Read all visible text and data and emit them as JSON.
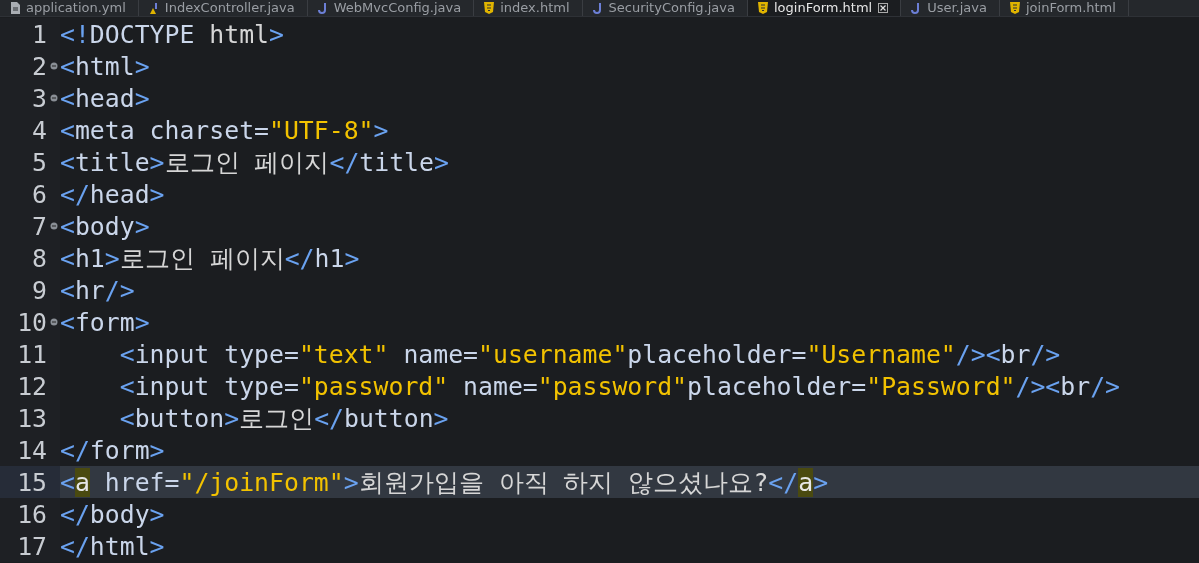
{
  "tabs": [
    {
      "label": "application.yml",
      "kind": "file",
      "selected": false
    },
    {
      "label": "IndexController.java",
      "kind": "java-warning",
      "selected": false
    },
    {
      "label": "WebMvcConfig.java",
      "kind": "java",
      "selected": false
    },
    {
      "label": "index.html",
      "kind": "html",
      "selected": false
    },
    {
      "label": "SecurityConfig.java",
      "kind": "java",
      "selected": false
    },
    {
      "label": "loginForm.html",
      "kind": "html",
      "selected": true
    },
    {
      "label": "User.java",
      "kind": "java",
      "selected": false
    },
    {
      "label": "joinForm.html",
      "kind": "html",
      "selected": false
    }
  ],
  "lines": [
    {
      "number": "1",
      "foldable": false,
      "current": false,
      "tokens": [
        {
          "kind": "punct",
          "text": "<!"
        },
        {
          "kind": "name",
          "text": "DOCTYPE"
        },
        {
          "kind": "text",
          "text": " html"
        },
        {
          "kind": "punct",
          "text": ">"
        }
      ]
    },
    {
      "number": "2",
      "foldable": true,
      "current": false,
      "tokens": [
        {
          "kind": "punct",
          "text": "<"
        },
        {
          "kind": "name",
          "text": "html"
        },
        {
          "kind": "punct",
          "text": ">"
        }
      ]
    },
    {
      "number": "3",
      "foldable": true,
      "current": false,
      "tokens": [
        {
          "kind": "punct",
          "text": "<"
        },
        {
          "kind": "name",
          "text": "head"
        },
        {
          "kind": "punct",
          "text": ">"
        }
      ]
    },
    {
      "number": "4",
      "foldable": false,
      "current": false,
      "tokens": [
        {
          "kind": "punct",
          "text": "<"
        },
        {
          "kind": "name",
          "text": "meta charset="
        },
        {
          "kind": "string",
          "text": "\"UTF-8\""
        },
        {
          "kind": "punct",
          "text": ">"
        }
      ]
    },
    {
      "number": "5",
      "foldable": false,
      "current": false,
      "tokens": [
        {
          "kind": "punct",
          "text": "<"
        },
        {
          "kind": "name",
          "text": "title"
        },
        {
          "kind": "punct",
          "text": ">"
        },
        {
          "kind": "text",
          "text": "로그인 페이지"
        },
        {
          "kind": "punct",
          "text": "</"
        },
        {
          "kind": "name",
          "text": "title"
        },
        {
          "kind": "punct",
          "text": ">"
        }
      ]
    },
    {
      "number": "6",
      "foldable": false,
      "current": false,
      "tokens": [
        {
          "kind": "punct",
          "text": "</"
        },
        {
          "kind": "name",
          "text": "head"
        },
        {
          "kind": "punct",
          "text": ">"
        }
      ]
    },
    {
      "number": "7",
      "foldable": true,
      "current": false,
      "tokens": [
        {
          "kind": "punct",
          "text": "<"
        },
        {
          "kind": "name",
          "text": "body"
        },
        {
          "kind": "punct",
          "text": ">"
        }
      ]
    },
    {
      "number": "8",
      "foldable": false,
      "current": false,
      "tokens": [
        {
          "kind": "punct",
          "text": "<"
        },
        {
          "kind": "name",
          "text": "h1"
        },
        {
          "kind": "punct",
          "text": ">"
        },
        {
          "kind": "text",
          "text": "로그인 페이지"
        },
        {
          "kind": "punct",
          "text": "</"
        },
        {
          "kind": "name",
          "text": "h1"
        },
        {
          "kind": "punct",
          "text": ">"
        }
      ]
    },
    {
      "number": "9",
      "foldable": false,
      "current": false,
      "tokens": [
        {
          "kind": "punct",
          "text": "<"
        },
        {
          "kind": "name",
          "text": "hr"
        },
        {
          "kind": "punct",
          "text": "/>"
        }
      ]
    },
    {
      "number": "10",
      "foldable": true,
      "current": false,
      "tokens": [
        {
          "kind": "punct",
          "text": "<"
        },
        {
          "kind": "name",
          "text": "form"
        },
        {
          "kind": "punct",
          "text": ">"
        }
      ]
    },
    {
      "number": "11",
      "foldable": false,
      "current": false,
      "indented": true,
      "tokens": [
        {
          "kind": "punct",
          "text": "<"
        },
        {
          "kind": "name",
          "text": "input type="
        },
        {
          "kind": "string",
          "text": "\"text\""
        },
        {
          "kind": "name",
          "text": " name="
        },
        {
          "kind": "string",
          "text": "\"username\""
        },
        {
          "kind": "name",
          "text": "placeholder="
        },
        {
          "kind": "string",
          "text": "\"Username\""
        },
        {
          "kind": "punct",
          "text": "/><"
        },
        {
          "kind": "name",
          "text": "br"
        },
        {
          "kind": "punct",
          "text": "/>"
        }
      ]
    },
    {
      "number": "12",
      "foldable": false,
      "current": false,
      "indented": true,
      "tokens": [
        {
          "kind": "punct",
          "text": "<"
        },
        {
          "kind": "name",
          "text": "input type="
        },
        {
          "kind": "string",
          "text": "\"password\""
        },
        {
          "kind": "name",
          "text": " name="
        },
        {
          "kind": "string",
          "text": "\"password\""
        },
        {
          "kind": "name",
          "text": "placeholder="
        },
        {
          "kind": "string",
          "text": "\"Password\""
        },
        {
          "kind": "punct",
          "text": "/><"
        },
        {
          "kind": "name",
          "text": "br"
        },
        {
          "kind": "punct",
          "text": "/>"
        }
      ]
    },
    {
      "number": "13",
      "foldable": false,
      "current": false,
      "indented": true,
      "tokens": [
        {
          "kind": "punct",
          "text": "<"
        },
        {
          "kind": "name",
          "text": "button"
        },
        {
          "kind": "punct",
          "text": ">"
        },
        {
          "kind": "text",
          "text": "로그인"
        },
        {
          "kind": "punct",
          "text": "</"
        },
        {
          "kind": "name",
          "text": "button"
        },
        {
          "kind": "punct",
          "text": ">"
        }
      ]
    },
    {
      "number": "14",
      "foldable": false,
      "current": false,
      "tokens": [
        {
          "kind": "punct",
          "text": "</"
        },
        {
          "kind": "name",
          "text": "form"
        },
        {
          "kind": "punct",
          "text": ">"
        }
      ]
    },
    {
      "number": "15",
      "foldable": false,
      "current": true,
      "tokens": [
        {
          "kind": "punct",
          "text": "<"
        },
        {
          "kind": "match",
          "text": "a"
        },
        {
          "kind": "name",
          "text": " href="
        },
        {
          "kind": "string",
          "text": "\"/joinForm\""
        },
        {
          "kind": "punct",
          "text": ">"
        },
        {
          "kind": "text",
          "text": "회원가입을 아직 하지 않으셨나요?"
        },
        {
          "kind": "punct",
          "text": "</"
        },
        {
          "kind": "match",
          "text": "a"
        },
        {
          "kind": "punct",
          "text": ">"
        }
      ]
    },
    {
      "number": "16",
      "foldable": false,
      "current": false,
      "tokens": [
        {
          "kind": "punct",
          "text": "</"
        },
        {
          "kind": "name",
          "text": "body"
        },
        {
          "kind": "punct",
          "text": ">"
        }
      ]
    },
    {
      "number": "17",
      "foldable": false,
      "current": false,
      "tokens": [
        {
          "kind": "punct",
          "text": "</"
        },
        {
          "kind": "name",
          "text": "html"
        },
        {
          "kind": "punct",
          "text": ">"
        }
      ]
    }
  ]
}
